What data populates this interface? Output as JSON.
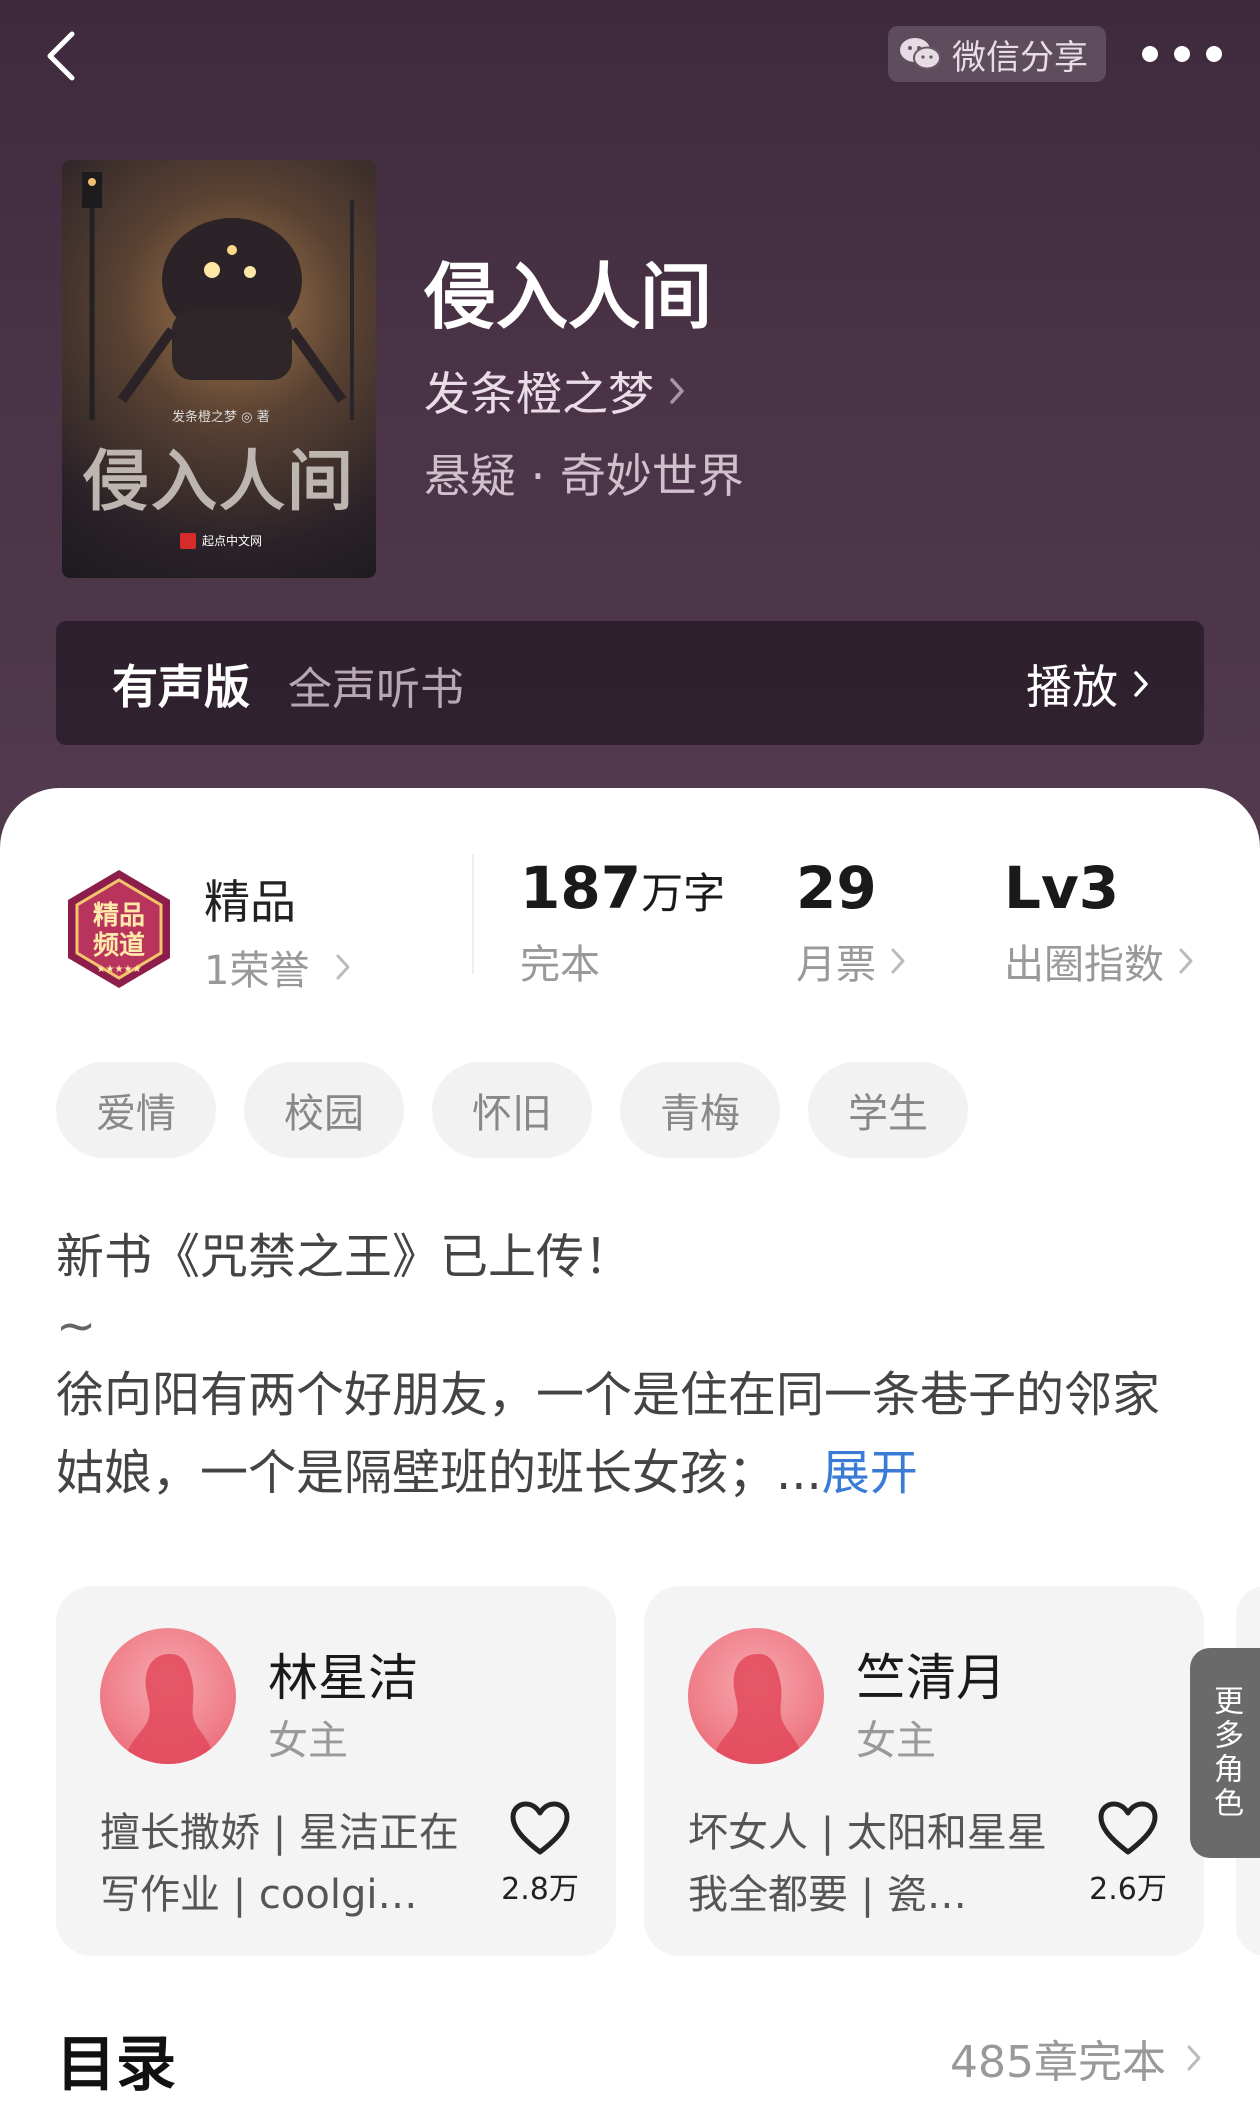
{
  "top_bar": {
    "share_label": "微信分享"
  },
  "book": {
    "title": "侵入人间",
    "author": "发条橙之梦",
    "genre": "悬疑 · 奇妙世界",
    "cover": {
      "title": "侵入人间",
      "author_text": "发条橙之梦 ◎ 著",
      "publisher": "起点中文网"
    }
  },
  "audio": {
    "label": "有声版",
    "subtitle": "全声听书",
    "play_label": "播放"
  },
  "honor": {
    "badge_text": "精品频道",
    "title": "精品",
    "subtitle": "1荣誉"
  },
  "stats": [
    {
      "value": "187",
      "unit": "万字",
      "label": "完本"
    },
    {
      "value": "29",
      "unit": "",
      "label": "月票"
    },
    {
      "value": "Lv3",
      "unit": "",
      "label": "出圈指数"
    }
  ],
  "tags": [
    "爱情",
    "校园",
    "怀旧",
    "青梅",
    "学生"
  ],
  "intro": {
    "line1": "新书《咒禁之王》已上传！",
    "line2": "~",
    "line3": "徐向阳有两个好朋友，一个是住在同一条巷子的邻家姑娘，一个是隔壁班的班长女孩；...",
    "expand_label": "展开"
  },
  "characters": [
    {
      "name": "林星洁",
      "role": "女主",
      "desc": "擅长撒娇 | 星洁正在写作业 | coolgi…",
      "likes": "2.8万"
    },
    {
      "name": "竺清月",
      "role": "女主",
      "desc": "坏女人 | 太阳和星星我全都要 | 瓷…",
      "likes": "2.6万"
    }
  ],
  "more_roles_label": "更多角色",
  "toc": {
    "title": "目录",
    "summary": "485章完本"
  },
  "colors": {
    "header_bg": "#4a3346",
    "link_blue": "#3a7bd5",
    "avatar_pink": "#ef7f8a"
  }
}
